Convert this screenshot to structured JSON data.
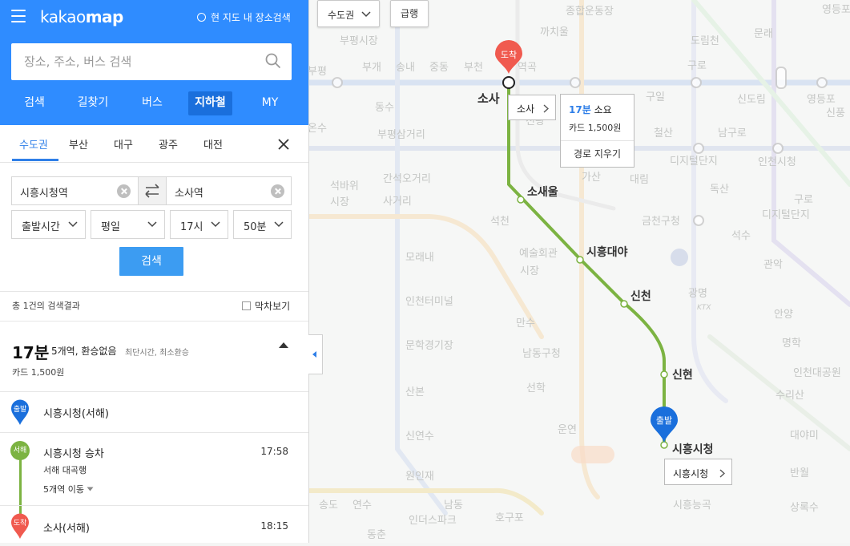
{
  "header": {
    "logo_light": "kakao",
    "logo_bold": "map",
    "local_search_label": "현 지도 내 장소검색",
    "search_placeholder": "장소, 주소, 버스 검색"
  },
  "main_tabs": [
    {
      "label": "검색"
    },
    {
      "label": "길찾기"
    },
    {
      "label": "버스"
    },
    {
      "label": "지하철",
      "active": true
    },
    {
      "label": "MY"
    }
  ],
  "region_tabs": [
    {
      "label": "수도권",
      "active": true
    },
    {
      "label": "부산"
    },
    {
      "label": "대구"
    },
    {
      "label": "광주"
    },
    {
      "label": "대전"
    }
  ],
  "route": {
    "origin": "시흥시청역",
    "destination": "소사역",
    "depart_mode": "출발시간",
    "day_type": "평일",
    "hour": "17시",
    "minute": "50분",
    "search_button": "검색"
  },
  "results": {
    "count_text": "총 1건의 검색결과",
    "last_train_label": "막차보기",
    "item": {
      "duration": "17분",
      "detail": "5개역, 환승없음",
      "tags": "최단시간, 최소환승",
      "fare": "카드 1,500원"
    },
    "steps": {
      "depart_badge": "출발",
      "depart_station": "시흥시청(서해)",
      "line_badge": "서해",
      "board_title": "시흥시청 승차",
      "board_time": "17:58",
      "direction": "서해 대곡행",
      "stops_text": "5개역 이동",
      "arrive_badge": "도착",
      "arrive_station": "소사(서해)",
      "arrive_time": "18:15"
    }
  },
  "map": {
    "region_select": "수도권",
    "express_button": "급행",
    "arrive_pin": "도착",
    "depart_pin": "출발",
    "route_color": "#7cb342",
    "route_stations": [
      "소사",
      "소새울",
      "시흥대야",
      "신천",
      "신현",
      "시흥시청"
    ],
    "origin_callout": "시흥시청",
    "dest_callout": "소사",
    "info": {
      "duration": "17분",
      "duration_suffix": "소요",
      "fare": "카드 1,500원",
      "clear_route": "경로 지우기"
    },
    "background_labels": [
      "종합운동장",
      "까치울",
      "도림천",
      "문래",
      "영등포",
      "부평시장",
      "부개",
      "송내",
      "중동",
      "부천",
      "역곡",
      "구로",
      "부평",
      "동수",
      "온수",
      "천왕",
      "구일",
      "신도림",
      "영등포",
      "신풍",
      "부평삼거리",
      "철산",
      "남구로",
      "간석오거리",
      "석바위",
      "시장",
      "가산",
      "디지털단지",
      "대림",
      "인천시청",
      "사거리",
      "석천",
      "독산",
      "구로",
      "디지털단지",
      "금천구청",
      "석수",
      "예술회관",
      "모래내",
      "시장",
      "관악",
      "광명",
      "인천터미널",
      "안양",
      "만수",
      "문학경기장",
      "남동구청",
      "명학",
      "인천대공원",
      "선학",
      "산본",
      "수리산",
      "운연",
      "신연수",
      "대야미",
      "원인재",
      "반월",
      "상록수",
      "송도",
      "연수",
      "남동",
      "인더스파크",
      "호구포",
      "시흥능곡",
      "동춘",
      "KTX"
    ]
  }
}
